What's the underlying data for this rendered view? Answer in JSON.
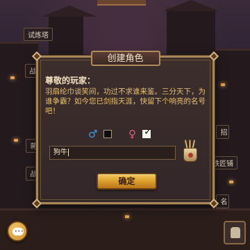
{
  "map_labels": {
    "tower": "试炼塔",
    "left_top": "战",
    "left_mid": "蒋",
    "right_top": "招",
    "right_mid": "铁匠铺",
    "right_low": "名",
    "left_low": "战"
  },
  "dialog": {
    "title": "创建角色",
    "greeting": "尊敬的玩家：",
    "description": "羽扇纶巾谈笑间，功过不求谁来鉴。三分天下，为谁争霸？如今您已剑指天涯，快留下个响亮的名号吧！",
    "gender": {
      "male_symbol": "♂",
      "female_symbol": "♀",
      "male_selected": false,
      "female_selected": true,
      "checkmark": "✓"
    },
    "name_input": {
      "value": "狗牛"
    },
    "random_name_icon": "dice-cup-icon",
    "confirm_label": "确定"
  },
  "colors": {
    "accent_gold": "#a68657",
    "description_text": "#e8c070",
    "male": "#3aa0e8",
    "female": "#e05a7a"
  }
}
